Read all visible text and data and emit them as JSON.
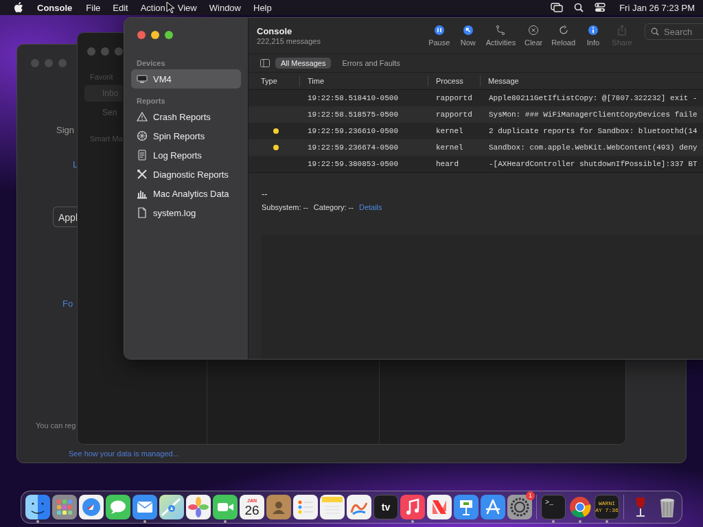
{
  "menu_bar": {
    "app_name": "Console",
    "menus": [
      "File",
      "Edit",
      "Action",
      "View",
      "Window",
      "Help"
    ],
    "clock": "Fri Jan 26  7:23 PM"
  },
  "sign_in_window": {
    "heading": "Sign",
    "link_top": "L",
    "field_value": "Appl",
    "link_bottom": "Fo",
    "note": "You can reg",
    "data_link": "See how your data is managed..."
  },
  "mail_window": {
    "section": "Favorit",
    "items": [
      {
        "label": "Inbo",
        "selected": true
      },
      {
        "label": "Sen",
        "selected": false
      }
    ],
    "section_2": "Smart Ma"
  },
  "console": {
    "title": "Console",
    "subtitle": "222,215 messages",
    "toolbar": [
      {
        "label": "Pause",
        "kind": "pause",
        "on": true,
        "disabled": false
      },
      {
        "label": "Now",
        "kind": "now",
        "on": true,
        "disabled": false
      },
      {
        "label": "Activities",
        "kind": "activities",
        "on": false,
        "disabled": false
      },
      {
        "label": "Clear",
        "kind": "clear",
        "on": false,
        "disabled": false
      },
      {
        "label": "Reload",
        "kind": "reload",
        "on": false,
        "disabled": false
      },
      {
        "label": "Info",
        "kind": "info",
        "on": true,
        "disabled": false
      },
      {
        "label": "Share",
        "kind": "share",
        "on": false,
        "disabled": true
      }
    ],
    "search": {
      "placeholder": "Search"
    },
    "filters": [
      {
        "label": "All Messages",
        "selected": true
      },
      {
        "label": "Errors and Faults",
        "selected": false
      }
    ],
    "sidebar": [
      {
        "heading": "Devices",
        "items": [
          {
            "label": "VM4",
            "kind": "device",
            "selected": true
          }
        ]
      },
      {
        "heading": "Reports",
        "items": [
          {
            "label": "Crash Reports",
            "kind": "crash",
            "selected": false
          },
          {
            "label": "Spin Reports",
            "kind": "spin",
            "selected": false
          },
          {
            "label": "Log Reports",
            "kind": "log",
            "selected": false
          },
          {
            "label": "Diagnostic Reports",
            "kind": "diagnostic",
            "selected": false
          },
          {
            "label": "Mac Analytics Data",
            "kind": "analytics",
            "selected": false
          },
          {
            "label": "system.log",
            "kind": "file",
            "selected": false
          }
        ]
      }
    ],
    "table": {
      "columns": [
        "Type",
        "Time",
        "Process",
        "Message"
      ],
      "rows": [
        {
          "kind": "default",
          "time": "19:22:58.518410-0500",
          "process": "rapportd",
          "message": "Apple80211GetIfListCopy: @[7807.322232] exit -"
        },
        {
          "kind": "default",
          "time": "19:22:58.518575-0500",
          "process": "rapportd",
          "message": "SysMon: ### WiFiManagerClientCopyDevices faile"
        },
        {
          "kind": "error",
          "time": "19:22:59.236610-0500",
          "process": "kernel",
          "message": "2 duplicate reports for Sandbox: bluetoothd(14"
        },
        {
          "kind": "error",
          "time": "19:22:59.236674-0500",
          "process": "kernel",
          "message": "Sandbox: com.apple.WebKit.WebContent(493) deny"
        },
        {
          "kind": "default",
          "time": "19:22:59.380853-0500",
          "process": "heard",
          "message": "-[AXHeardController shutdownIfPossible]:337 BT"
        }
      ]
    },
    "detail": {
      "title": "--",
      "subsystem": "Subsystem: --",
      "category": "Category: --",
      "link": "Details"
    }
  },
  "dock": {
    "apps": [
      {
        "kind": "finder",
        "running": true
      },
      {
        "kind": "launchpad",
        "running": false
      },
      {
        "kind": "safari",
        "running": false
      },
      {
        "kind": "messages",
        "running": false
      },
      {
        "kind": "mail",
        "running": true
      },
      {
        "kind": "maps",
        "running": false
      },
      {
        "kind": "photos",
        "running": false
      },
      {
        "kind": "facetime",
        "running": true
      },
      {
        "kind": "calendar",
        "running": false,
        "month": "JAN",
        "day": "26"
      },
      {
        "kind": "contacts",
        "running": false
      },
      {
        "kind": "reminders",
        "running": false
      },
      {
        "kind": "notes",
        "running": false
      },
      {
        "kind": "freeform",
        "running": false
      },
      {
        "kind": "tv",
        "running": false,
        "label": "tv"
      },
      {
        "kind": "music",
        "running": true
      },
      {
        "kind": "news",
        "running": false
      },
      {
        "kind": "keynote",
        "running": false
      },
      {
        "kind": "appstore",
        "running": false
      },
      {
        "kind": "settings",
        "running": false,
        "badge": "1"
      }
    ],
    "recent": [
      {
        "kind": "terminal",
        "running": true,
        "label": ">_"
      },
      {
        "kind": "chrome",
        "running": true
      },
      {
        "kind": "console",
        "running": true,
        "lines": [
          "WARNI",
          "AY 7:36"
        ]
      }
    ],
    "extras": [
      {
        "kind": "wine",
        "running": false
      },
      {
        "kind": "trash",
        "running": false
      }
    ]
  }
}
